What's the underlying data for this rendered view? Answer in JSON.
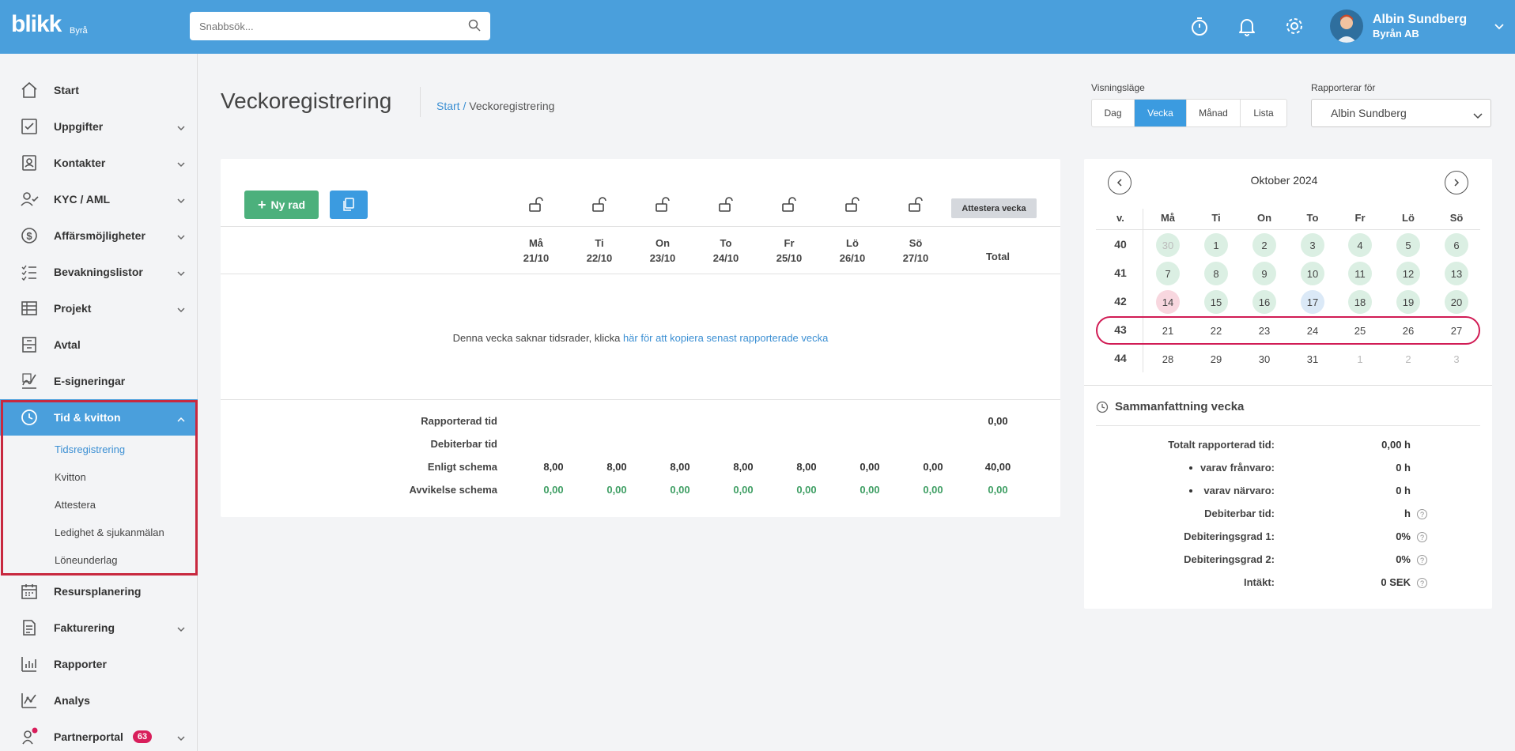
{
  "app": {
    "logo": "blikk",
    "logo_sub": "Byrå"
  },
  "search": {
    "placeholder": "Snabbsök..."
  },
  "user": {
    "name": "Albin Sundberg",
    "org": "Byrån AB"
  },
  "sidebar": {
    "items": [
      {
        "label": "Start",
        "icon": "home-icon"
      },
      {
        "label": "Uppgifter",
        "icon": "checkbox-icon"
      },
      {
        "label": "Kontakter",
        "icon": "contact-card-icon"
      },
      {
        "label": "KYC / AML",
        "icon": "user-check-icon"
      },
      {
        "label": "Affärsmöjligheter",
        "icon": "dollar-circle-icon"
      },
      {
        "label": "Bevakningslistor",
        "icon": "checklist-icon"
      },
      {
        "label": "Projekt",
        "icon": "table-icon"
      },
      {
        "label": "Avtal",
        "icon": "archive-icon"
      },
      {
        "label": "E-signeringar",
        "icon": "signature-icon"
      },
      {
        "label": "Tid & kvitton",
        "icon": "clock-icon"
      },
      {
        "label": "Resursplanering",
        "icon": "calendar-icon"
      },
      {
        "label": "Fakturering",
        "icon": "document-icon"
      },
      {
        "label": "Rapporter",
        "icon": "bar-chart-icon"
      },
      {
        "label": "Analys",
        "icon": "line-chart-icon"
      },
      {
        "label": "Partnerportal",
        "icon": "partner-icon",
        "badge": "63"
      }
    ],
    "sub_items": [
      "Tidsregistrering",
      "Kvitton",
      "Attestera",
      "Ledighet & sjukanmälan",
      "Löneunderlag"
    ]
  },
  "page": {
    "title": "Veckoregistrering",
    "breadcrumb_home": "Start",
    "breadcrumb_sep": " / ",
    "breadcrumb_current": "Veckoregistrering"
  },
  "view_mode": {
    "label": "Visningsläge",
    "options": [
      "Dag",
      "Vecka",
      "Månad",
      "Lista"
    ],
    "selected": "Vecka"
  },
  "reporter": {
    "label": "Rapporterar för",
    "value": "Albin Sundberg"
  },
  "toolbar": {
    "new_row": "Ny rad",
    "attest_week": "Attestera vecka"
  },
  "week": {
    "days": [
      {
        "name": "Må",
        "date": "21/10"
      },
      {
        "name": "Ti",
        "date": "22/10"
      },
      {
        "name": "On",
        "date": "23/10"
      },
      {
        "name": "To",
        "date": "24/10"
      },
      {
        "name": "Fr",
        "date": "25/10"
      },
      {
        "name": "Lö",
        "date": "26/10"
      },
      {
        "name": "Sö",
        "date": "27/10"
      }
    ],
    "total_header": "Total",
    "empty_text": "Denna vecka saknar tidsrader, klicka ",
    "empty_link": "här för att kopiera senast rapporterade vecka",
    "rows": {
      "reported": {
        "label": "Rapporterad tid",
        "total": "0,00"
      },
      "billable": {
        "label": "Debiterbar tid"
      },
      "schedule": {
        "label": "Enligt schema",
        "values": [
          "8,00",
          "8,00",
          "8,00",
          "8,00",
          "8,00",
          "0,00",
          "0,00"
        ],
        "total": "40,00"
      },
      "deviation": {
        "label": "Avvikelse schema",
        "values": [
          "0,00",
          "0,00",
          "0,00",
          "0,00",
          "0,00",
          "0,00",
          "0,00"
        ],
        "total": "0,00"
      }
    }
  },
  "calendar": {
    "title": "Oktober 2024",
    "week_header": "v.",
    "day_headers": [
      "Må",
      "Ti",
      "On",
      "To",
      "Fr",
      "Lö",
      "Sö"
    ],
    "weeks": [
      {
        "num": "40",
        "days": [
          "30",
          "1",
          "2",
          "3",
          "4",
          "5",
          "6"
        ]
      },
      {
        "num": "41",
        "days": [
          "7",
          "8",
          "9",
          "10",
          "11",
          "12",
          "13"
        ]
      },
      {
        "num": "42",
        "days": [
          "14",
          "15",
          "16",
          "17",
          "18",
          "19",
          "20"
        ]
      },
      {
        "num": "43",
        "days": [
          "21",
          "22",
          "23",
          "24",
          "25",
          "26",
          "27"
        ]
      },
      {
        "num": "44",
        "days": [
          "28",
          "29",
          "30",
          "31",
          "1",
          "2",
          "3"
        ]
      }
    ]
  },
  "summary": {
    "title": "Sammanfattning vecka",
    "rows": [
      {
        "label": "Totalt rapporterad tid:",
        "value": "0,00 h"
      },
      {
        "label": "varav frånvaro:",
        "value": "0 h"
      },
      {
        "label": "varav närvaro:",
        "value": "0 h"
      },
      {
        "label": "Debiterbar tid:",
        "value": "h"
      },
      {
        "label": "Debiteringsgrad 1:",
        "value": "0%"
      },
      {
        "label": "Debiteringsgrad 2:",
        "value": "0%"
      },
      {
        "label": "Intäkt:",
        "value": "0 SEK"
      }
    ],
    "help_glyph": "?"
  },
  "colors": {
    "brand": "#4a9fdc",
    "active_nav": "#4a9fdc",
    "green_button": "#4cb07c",
    "highlight_border": "#c8283f",
    "week_ring": "#d11c55",
    "deviation_green": "#3e9e63"
  }
}
